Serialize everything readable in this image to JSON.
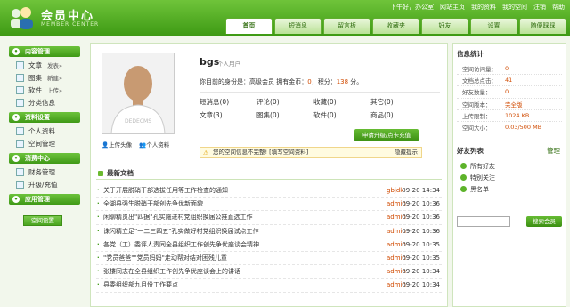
{
  "header": {
    "title": "会员中心",
    "subtitle": "MEMBER CENTER",
    "top_links": [
      "下午好，办公室",
      "网站主页",
      "我的资料",
      "我的空间",
      "注销",
      "帮助"
    ],
    "nav": [
      "首页",
      "短消息",
      "留言板",
      "收藏夹",
      "好友",
      "设置",
      "随便踩踩"
    ]
  },
  "sidebar": {
    "sections": [
      {
        "title": "内容管理",
        "items": [
          {
            "label": "文章",
            "sub": "发表»"
          },
          {
            "label": "图集",
            "sub": "新建»"
          },
          {
            "label": "软件",
            "sub": "上传»"
          },
          {
            "label": "分类信息",
            "sub": ""
          }
        ]
      },
      {
        "title": "资料设置",
        "items": [
          {
            "label": "个人资料",
            "sub": ""
          },
          {
            "label": "空间管理",
            "sub": ""
          }
        ]
      },
      {
        "title": "消费中心",
        "items": [
          {
            "label": "财务管理",
            "sub": ""
          },
          {
            "label": "升级/充值",
            "sub": ""
          }
        ]
      },
      {
        "title": "应用管理",
        "items": []
      }
    ],
    "space_button": "空间设置"
  },
  "profile": {
    "avatar_text": "DEDECMS",
    "upload_avatar": "上传头像",
    "personal_info": "个人资料",
    "username": "bgs",
    "group": "个人用户",
    "status_prefix": "你目前的身份是：",
    "status_level": "高级会员",
    "status_mid": " 拥有金币：",
    "coins": "0",
    "status_score_label": "，积分：",
    "score": "138",
    "status_suffix": " 分。",
    "stats": [
      "短消息(0)",
      "评论(0)",
      "收藏(0)",
      "其它(0)",
      "文章(3)",
      "图集(0)",
      "软件(0)",
      "商品(0)"
    ],
    "upgrade_button": "申请升级/点卡充值",
    "notice": "您的空间信息不完整! [填写空间资料]",
    "notice_hide": "隐藏提示"
  },
  "news": {
    "title": "最新文档",
    "items": [
      {
        "title": "关于开展脱硝干部选拔任用等工作检查的通知",
        "author": "gbjdk",
        "time": "09-20 14:34"
      },
      {
        "title": "全湖县强生脱硝干部创先争优新面貌",
        "author": "admin",
        "time": "09-20 10:36"
      },
      {
        "title": "闲聊精贯出\"四据\"孔实施进村党组织换届公推直选工作",
        "author": "admin",
        "time": "09-20 10:36"
      },
      {
        "title": "诛闪精立足\"一二三四五\"孔实做好村党组织换届试点工作",
        "author": "admin",
        "time": "09-20 10:36"
      },
      {
        "title": "各党（工）委评人责同全县组织工作创先争优座谈会精神",
        "author": "admin",
        "time": "09-20 10:35"
      },
      {
        "title": "\"党员爸爸\"\"党员妈妈\"走动帮对结对困残儿童",
        "author": "admin",
        "time": "09-20 10:35"
      },
      {
        "title": "张楼同志在全县组织工作创先争优座谈会上的讲话",
        "author": "admin",
        "time": "09-20 10:34"
      },
      {
        "title": "县委组织部九月份工作要点",
        "author": "admin",
        "time": "09-20 10:34"
      }
    ]
  },
  "right": {
    "info_title": "信息统计",
    "info": [
      {
        "k": "空间访问量：",
        "v": "0"
      },
      {
        "k": "文档总点击：",
        "v": "41"
      },
      {
        "k": "好友数量：",
        "v": "0"
      },
      {
        "k": "空间版本：",
        "v": "完全版"
      },
      {
        "k": "上传限制：",
        "v": "1024 KB"
      },
      {
        "k": "空间大小：",
        "v": "0.03/500 MB"
      }
    ],
    "friends_title": "好友列表",
    "friends_manage": "管理",
    "friends": [
      "所有好友",
      "特别关注",
      "黑名单"
    ],
    "search_button": "搜索会员"
  },
  "colors": {
    "brand_green": "#3e9a14",
    "accent_orange": "#d04a00"
  }
}
